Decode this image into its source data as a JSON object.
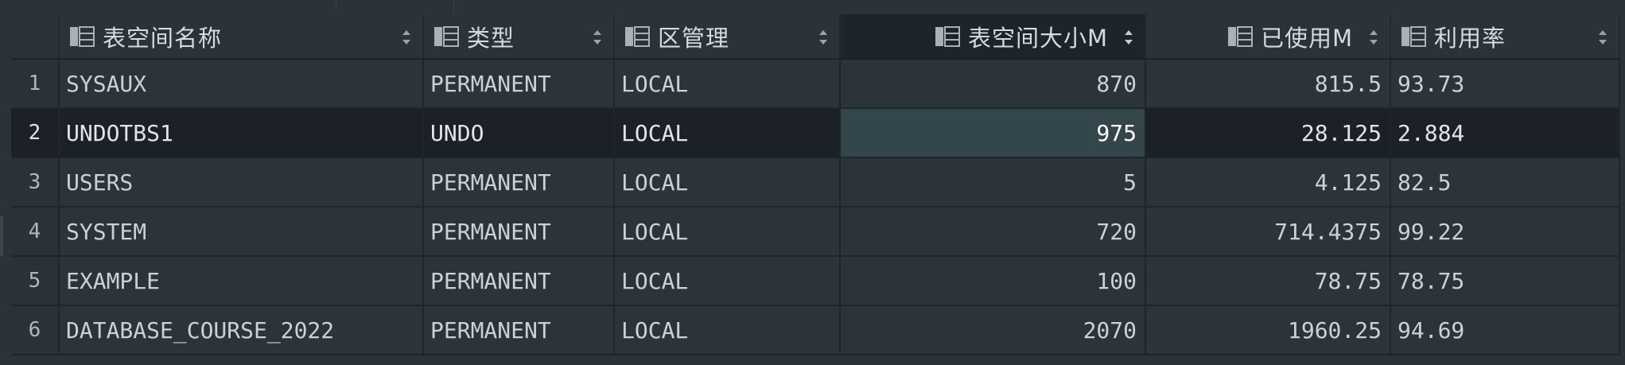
{
  "columns": [
    {
      "key": "name",
      "label": "表空间名称",
      "icon": "table-column-icon",
      "align": "left"
    },
    {
      "key": "type",
      "label": "类型",
      "icon": "table-column-icon",
      "align": "left"
    },
    {
      "key": "extent",
      "label": "区管理",
      "icon": "table-column-icon",
      "align": "left"
    },
    {
      "key": "size",
      "label": "表空间大小M",
      "icon": "table-column-icon",
      "align": "right",
      "sorted": true
    },
    {
      "key": "used",
      "label": "已使用M",
      "icon": "table-column-icon",
      "align": "right"
    },
    {
      "key": "ratio",
      "label": "利用率",
      "icon": "table-column-icon",
      "align": "left"
    }
  ],
  "rows": [
    {
      "num": "1",
      "name": "SYSAUX",
      "type": "PERMANENT",
      "extent": "LOCAL",
      "size": "870",
      "used": "815.5",
      "ratio": "93.73"
    },
    {
      "num": "2",
      "name": "UNDOTBS1",
      "type": "UNDO",
      "extent": "LOCAL",
      "size": "975",
      "used": "28.125",
      "ratio": "2.884"
    },
    {
      "num": "3",
      "name": "USERS",
      "type": "PERMANENT",
      "extent": "LOCAL",
      "size": "5",
      "used": "4.125",
      "ratio": "82.5"
    },
    {
      "num": "4",
      "name": "SYSTEM",
      "type": "PERMANENT",
      "extent": "LOCAL",
      "size": "720",
      "used": "714.4375",
      "ratio": "99.22"
    },
    {
      "num": "5",
      "name": "EXAMPLE",
      "type": "PERMANENT",
      "extent": "LOCAL",
      "size": "100",
      "used": "78.75",
      "ratio": "78.75"
    },
    {
      "num": "6",
      "name": "DATABASE_COURSE_2022",
      "type": "PERMANENT",
      "extent": "LOCAL",
      "size": "2070",
      "used": "1960.25",
      "ratio": "94.69"
    }
  ],
  "selection": {
    "row": "2",
    "column": "size"
  },
  "colors": {
    "background": "#2b3238",
    "header": "#2a3339",
    "selected_row": "#1b2126",
    "active_cell": "#32464b",
    "text": "#c9d1d9"
  }
}
